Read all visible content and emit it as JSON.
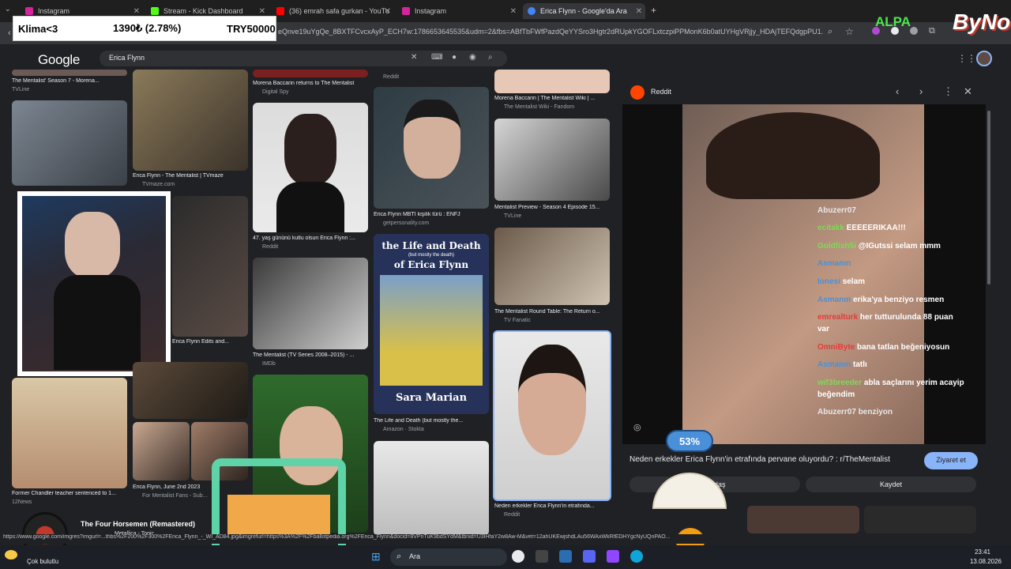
{
  "tabs": [
    {
      "label": "Instagram"
    },
    {
      "label": "Stream - Kick Dashboard"
    },
    {
      "label": "(36) emrah safa gurkan - YouTu"
    },
    {
      "label": "Instagram"
    },
    {
      "label": "Erica Flynn - Google'da Ara"
    }
  ],
  "address_url": "eQnve19uYgQe_8BXTFCvcxAyP_ECH7w:1786653645535&udm=2&fbs=ABfTbFWfPazdQeYYSro3Hgtr2dRUpkYGOFLxtczpiPPMonK6b0atUYHgVRjjy_HDAjTEFQdgpPU1...",
  "ticker": {
    "left": "Klima<3",
    "mid": "1390₺ (2.78%)",
    "right": "TRY50000"
  },
  "overlay_logo": "ALPA",
  "overlay_brand": "ByNo",
  "google": {
    "logo": "Google",
    "query": "Erica Flynn"
  },
  "results": {
    "c1": [
      {
        "cap": "The Mentalist' Season 7 - Morena...",
        "src": "TVLine"
      },
      {
        "cap": "Former Chandler teacher sentenced to 1...",
        "src": "12News"
      }
    ],
    "c2": [
      {
        "cap": "Erica Flynn - The Mentalist | TVmaze",
        "src": "TVmaze.com"
      },
      {
        "cap": "Erica Flynn Edits and...",
        "src": ""
      },
      {
        "cap": "Erica Flynn, June 2nd 2023",
        "src": "For Mentalist Fans - Sub..."
      }
    ],
    "c3": [
      {
        "cap": "Morena Baccarin returns to The Mentalist",
        "src": "Digital Spy"
      },
      {
        "cap": "47. yaş gününü kutlu olsun Erica Flynn :...",
        "src": "Reddit"
      },
      {
        "cap": "The Mentalist (TV Series 2008–2015) - ...",
        "src": "IMDb"
      }
    ],
    "c4": [
      {
        "cap": "",
        "src": "Reddit"
      },
      {
        "cap": "Erica Flynn MBTI kişilik türü : ENFJ",
        "src": "getpersonality.com"
      },
      {
        "cap": "The Life and Death (but mostly the...",
        "src": "Amazon · Stokta"
      }
    ],
    "c5": [
      {
        "cap": "Morena Baccarin | The Mentalist Wiki | ...",
        "src": "The Mentalist Wiki - Fandom"
      },
      {
        "cap": "Mentalist Preview - Season 4 Episode 15...",
        "src": "TVLine"
      },
      {
        "cap": "The Mentalist Round Table: The Return o...",
        "src": "TV Fanatic"
      },
      {
        "cap": "Neden erkekler Erica Flynn'in etrafında...",
        "src": "Reddit"
      }
    ],
    "book": {
      "title": "the Life and Death",
      "sub": "(but mostly the death)",
      "name": "of Erica Flynn",
      "author": "Sara Marian"
    }
  },
  "panel": {
    "source": "Reddit",
    "title": "Neden erkekler Erica Flynn'in etrafında pervane oluyordu? : r/TheMentalist",
    "visit": "Ziyaret et",
    "share": "Paylaş",
    "save": "Kaydet",
    "progress_label": "53%",
    "progress": 0.53
  },
  "chat": [
    {
      "user": "Abuzerr07",
      "msg": ""
    },
    {
      "user": "ecitakk",
      "msg": "EEEEERIKAA!!!"
    },
    {
      "user": "Goldfish5i",
      "msg": "@IGutssi selam mmm"
    },
    {
      "user": "Asmanın",
      "msg": ""
    },
    {
      "user": "Ionesi",
      "msg": "selam"
    },
    {
      "user": "Asmanın",
      "msg": "erika'ya benziyo resmen"
    },
    {
      "user": "emrealturk",
      "msg": "her tutturulunda 88 puan"
    },
    {
      "user": "",
      "msg": "var"
    },
    {
      "user": "OmniByte",
      "msg": "bana tatlan beğeniyosun"
    },
    {
      "user": "Asmanın",
      "msg": "tatlı"
    },
    {
      "user": "wif3breeder",
      "msg": "abla saçlarını yerim acayip"
    },
    {
      "user": "",
      "msg": "beğendim"
    },
    {
      "user": "Abuzerr07",
      "msg": "benziyon"
    }
  ],
  "music": {
    "title": "The Four Horsemen (Remastered)",
    "artist": "Metallica - Topic"
  },
  "status_url": "https://www.google.com/imgres?imgurl=...thbs%2F200%2F300%2FErica_Flynn_-_WI_AD84.jpg&imgrefurl=https%3A%2F%2Fballotpedia.org%2FErica_Flynn&docid=8VPnTuK9bdSYdM&tbnid=U3IHfaY2w8Aw-M&vet=12ahUKEwjshdLAu56WAxWkRfEDHYgcNyUQnPAO...",
  "taskbar": {
    "weather": "Çok bulutlu",
    "search": "Ara",
    "time": "23:41",
    "date": "13.08.2026"
  },
  "colors": {
    "accent": "#8ab4f8",
    "chat_green": "#7ed957",
    "badge_blue": "#4a90d9"
  }
}
